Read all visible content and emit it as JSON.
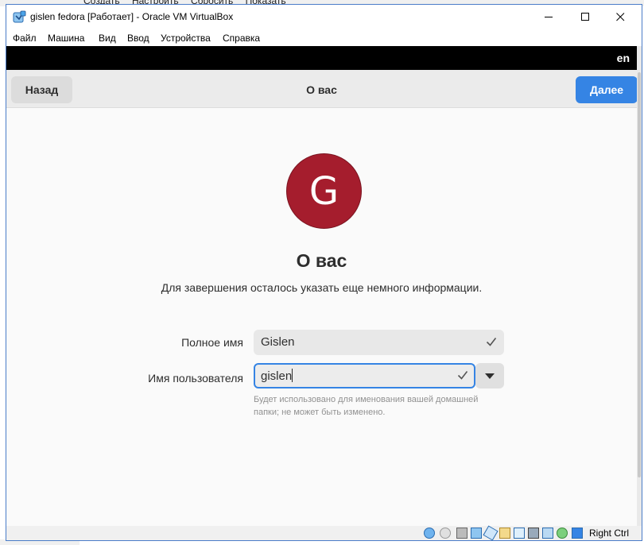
{
  "host": {
    "menu": [
      "Создать",
      "Настроить",
      "Сбросить",
      "Показать"
    ]
  },
  "window": {
    "title": "gislen fedora [Работает] - Oracle VM VirtualBox"
  },
  "menubar": [
    "Файл",
    "Машина",
    "Вид",
    "Ввод",
    "Устройства",
    "Справка"
  ],
  "guest": {
    "language": "en",
    "header": {
      "back_label": "Назад",
      "title": "О вас",
      "next_label": "Далее"
    },
    "avatar_letter": "G",
    "heading": "О вас",
    "subtitle": "Для завершения осталось указать еще немного информации.",
    "full_name": {
      "label": "Полное имя",
      "value": "Gislen"
    },
    "username": {
      "label": "Имя пользователя",
      "value": "gislen",
      "hint": "Будет использовано для именования вашей домашней папки; не может быть изменено."
    }
  },
  "statusbar": {
    "host_key": "Right Ctrl",
    "icons": [
      "hard-disk-icon",
      "optical-drive-icon",
      "audio-icon",
      "network-icon",
      "usb-icon",
      "shared-folders-icon",
      "display-icon",
      "video-capture-icon",
      "recording-icon",
      "mouse-integration-icon",
      "arrow-down-icon"
    ]
  },
  "colors": {
    "accent": "#3584e4",
    "avatar": "#a51d2d",
    "titlebar_border": "#4a7cc8"
  }
}
